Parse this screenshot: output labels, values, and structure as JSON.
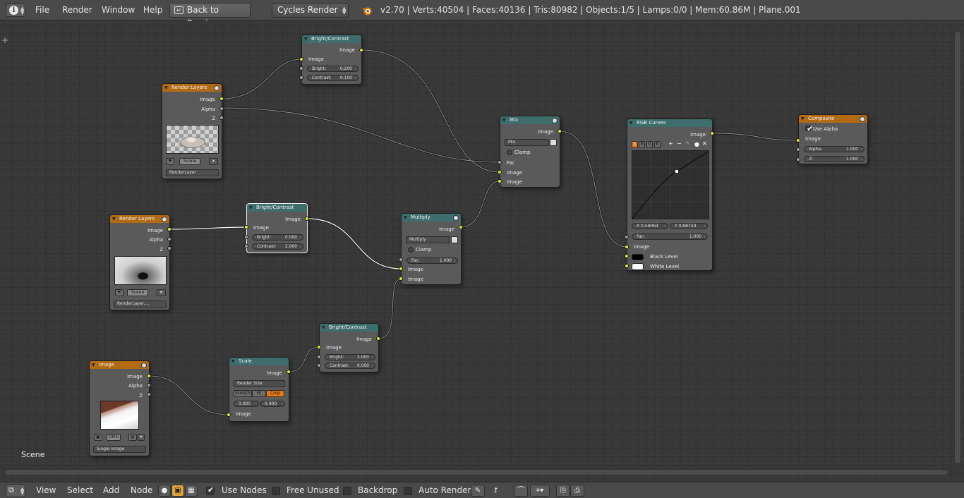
{
  "topbar": {
    "menus": [
      "File",
      "Render",
      "Window",
      "Help"
    ],
    "back_label": "Back to Previous",
    "engine": "Cycles Render",
    "stats": "v2.70 | Verts:40504 | Faces:40136 | Tris:80982 | Objects:1/5 | Lamps:0/0 | Mem:60.86M | Plane.001"
  },
  "editor": {
    "scene_label": "Scene"
  },
  "nodes": {
    "bc1": {
      "title": "Bright/Contrast",
      "out": "Image",
      "in": "Image",
      "bright_label": "Bright:",
      "bright": "0.200",
      "contrast_label": "Contrast:",
      "contrast": "0.100"
    },
    "rl1": {
      "title": "Render Layers",
      "outs": [
        "Image",
        "Alpha",
        "Z"
      ],
      "scene": "Scene",
      "layer": "RenderLayer"
    },
    "rl2": {
      "title": "Render Layers",
      "outs": [
        "Image",
        "Alpha",
        "Z"
      ],
      "scene": "Scene",
      "layer": "RenderLayer...."
    },
    "bc2": {
      "title": "Bright/Contrast",
      "out": "Image",
      "in": "Image",
      "bright_label": "Bright:",
      "bright": "0.000",
      "contrast_label": "Contrast:",
      "contrast": "2.000"
    },
    "multiply": {
      "title": "Multiply",
      "out": "Image",
      "mode": "Multiply",
      "clamp": "Clamp",
      "fac_label": "Fac:",
      "fac": "1.000",
      "in1": "Image",
      "in2": "Image"
    },
    "mix": {
      "title": "Mix",
      "out": "Image",
      "mode": "Mix",
      "clamp": "Clamp",
      "fac": "Fac",
      "in1": "Image",
      "in2": "Image"
    },
    "curves": {
      "title": "RGB Curves",
      "out": "Image",
      "channels": [
        "C",
        "R",
        "G",
        "B"
      ],
      "x": "X 0.59063",
      "y": "Y 0.68750",
      "fac_label": "Fac:",
      "fac": "1.000",
      "in": "Image",
      "black": "Black Level",
      "white": "White Level"
    },
    "composite": {
      "title": "Composite",
      "use_alpha": "Use Alpha",
      "in": "Image",
      "alpha_label": "Alpha:",
      "alpha": "1.000",
      "z_label": "Z:",
      "z": "1.000"
    },
    "bc3": {
      "title": "Bright/Contrast",
      "out": "Image",
      "in": "Image",
      "bright_label": "Bright:",
      "bright": "3.000",
      "contrast_label": "Contrast:",
      "contrast": "0.000"
    },
    "scale": {
      "title": "Scale",
      "out": "Image",
      "mode": "Render Size",
      "opts": [
        "Stretch",
        "Fit",
        "Crop"
      ],
      "x": "0.000",
      "y": "0.000",
      "in": "Image"
    },
    "image": {
      "title": "Image",
      "outs": [
        "Image",
        "Alpha",
        "Z"
      ],
      "name": "OMG",
      "source": "Single Image"
    }
  },
  "bottombar": {
    "menus": [
      "View",
      "Select",
      "Add",
      "Node"
    ],
    "use_nodes": "Use Nodes",
    "free_unused": "Free Unused",
    "backdrop": "Backdrop",
    "auto_render": "Auto Render"
  },
  "colors": {
    "header_input": "#b26a14",
    "header_filter": "#3d6d6c",
    "socket_color": "#e7e72b",
    "socket_value": "#a1a1a1",
    "accent": "#e87d0d"
  }
}
